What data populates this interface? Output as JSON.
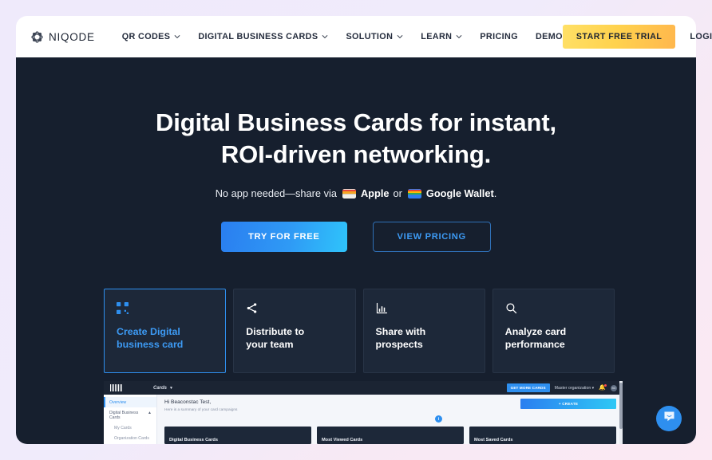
{
  "brand": {
    "name": "NIQODE",
    "logo_icon": "niqode-floral-qr-logo"
  },
  "nav": {
    "items": [
      {
        "label": "QR CODES",
        "has_dropdown": true
      },
      {
        "label": "DIGITAL BUSINESS CARDS",
        "has_dropdown": true
      },
      {
        "label": "SOLUTION",
        "has_dropdown": true
      },
      {
        "label": "LEARN",
        "has_dropdown": true
      },
      {
        "label": "PRICING",
        "has_dropdown": false
      },
      {
        "label": "DEMO",
        "has_dropdown": false
      }
    ],
    "trial_label": "START FREE TRIAL",
    "login_label": "LOGIN"
  },
  "hero": {
    "heading_line1": "Digital Business Cards for instant,",
    "heading_line2": "ROI-driven networking.",
    "sub_prefix": "No app needed—share via",
    "sub_apple": "Apple",
    "sub_or": "or",
    "sub_google": "Google Wallet",
    "sub_period": ".",
    "cta_primary": "TRY FOR FREE",
    "cta_secondary": "VIEW PRICING"
  },
  "feature_cards": [
    {
      "title_line1": "Create Digital",
      "title_line2": "business card",
      "icon": "qr-code-icon",
      "active": true
    },
    {
      "title_line1": "Distribute to",
      "title_line2": "your team",
      "icon": "share-icon",
      "active": false
    },
    {
      "title_line1": "Share with",
      "title_line2": "prospects",
      "icon": "bar-chart-icon",
      "active": false
    },
    {
      "title_line1": "Analyze card",
      "title_line2": "performance",
      "icon": "search-icon",
      "active": false
    }
  ],
  "dashboard": {
    "cards_menu": "Cards",
    "get_more_cards": "GET MORE CARDS",
    "organization": "Master organization",
    "avatar_initials": "BD",
    "sidebar": [
      {
        "label": "Overview",
        "selected": true,
        "indented": false
      },
      {
        "label": "Digital Business Cards",
        "selected": false,
        "indented": false,
        "caret": "⌃"
      },
      {
        "label": "My Cards",
        "selected": false,
        "indented": true
      },
      {
        "label": "Organization Cards",
        "selected": false,
        "indented": true
      }
    ],
    "greeting": "Hi Beaconstac Test,",
    "summary": "Here is a summary of your card campaigns",
    "create_label": "+ CREATE",
    "info_badge": "i",
    "tiles": [
      {
        "title": "Digital Business Cards"
      },
      {
        "title": "Most Viewed Cards"
      },
      {
        "title": "Most Saved Cards"
      }
    ]
  },
  "chat": {
    "icon": "chat-bubble-icon"
  },
  "colors": {
    "page_bg": "#efeafb",
    "hero_bg": "#161f2e",
    "accent_blue": "#2e8fef",
    "trial_yellow": "#ffd24d",
    "card_bg": "#1d2839"
  }
}
